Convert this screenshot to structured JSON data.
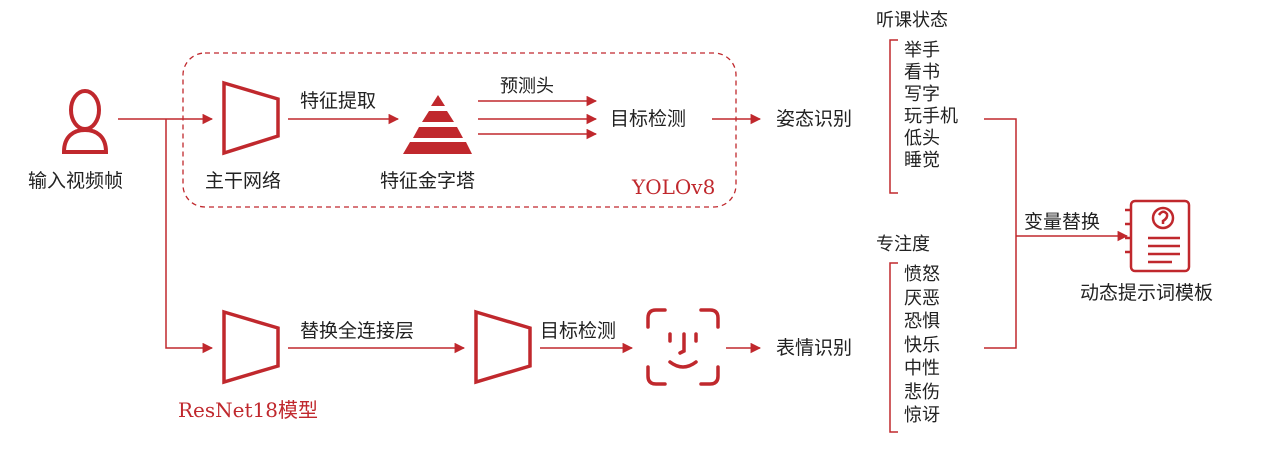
{
  "input": {
    "label": "输入视频帧",
    "icon": "person-icon"
  },
  "yolo": {
    "group_label": "YOLOv8",
    "backbone_label": "主干网络",
    "feature_extract_label": "特征提取",
    "pyramid_label": "特征金字塔",
    "head_label": "预测头",
    "detect_label": "目标检测"
  },
  "resnet": {
    "model_label": "ResNet18模型",
    "replace_fc_label": "替换全连接层",
    "detect_label": "目标检测",
    "face_icon": "face-scan-icon"
  },
  "posture": {
    "label": "姿态识别",
    "category_title": "听课状态",
    "items": [
      "举手",
      "看书",
      "写字",
      "玩手机",
      "低头",
      "睡觉"
    ]
  },
  "expression": {
    "label": "表情识别",
    "category_title": "专注度",
    "items": [
      "愤怒",
      "厌恶",
      "恐惧",
      "快乐",
      "中性",
      "悲伤",
      "惊讶"
    ]
  },
  "output": {
    "substitute_label": "变量替换",
    "template_label": "动态提示词模板",
    "icon": "document-question-icon"
  },
  "colors": {
    "accent": "#c0282d",
    "text": "#222222"
  }
}
